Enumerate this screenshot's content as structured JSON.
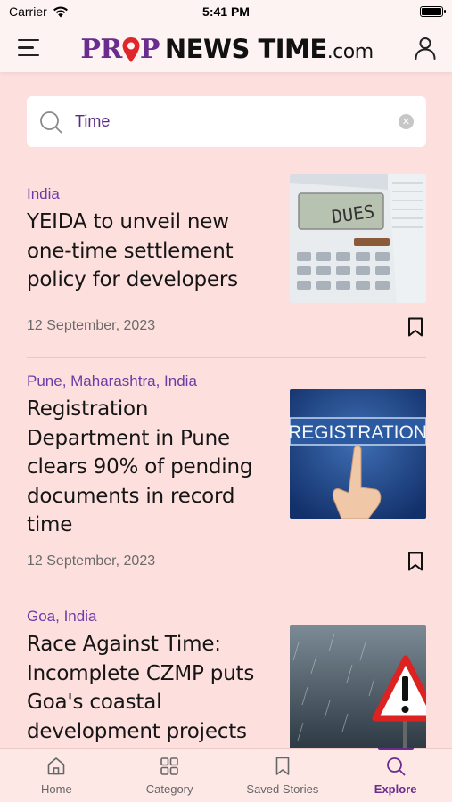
{
  "status_bar": {
    "carrier": "Carrier",
    "time": "5:41 PM"
  },
  "header": {
    "logo_prop_left": "PR",
    "logo_prop_right": "P",
    "logo_news": "NEWS TIME",
    "logo_com": ".com"
  },
  "search": {
    "value": "Time",
    "placeholder": "Search"
  },
  "articles": [
    {
      "category": "India",
      "title": "YEIDA to unveil new one-time settlement policy for developers",
      "date": "12 September, 2023",
      "image_text": "DUES"
    },
    {
      "category": "Pune, Maharashtra, India",
      "title": "Registration Department in Pune clears 90% of pending documents in record time",
      "date": "12 September, 2023",
      "image_text": "REGISTRATION"
    },
    {
      "category": "Goa, India",
      "title": "Race Against Time: Incomplete CZMP puts Goa's coastal development projects",
      "date": "",
      "image_text": ""
    }
  ],
  "bottom_nav": [
    {
      "label": "Home",
      "icon": "home-icon",
      "active": false
    },
    {
      "label": "Category",
      "icon": "grid-icon",
      "active": false
    },
    {
      "label": "Saved Stories",
      "icon": "bookmark-icon",
      "active": false
    },
    {
      "label": "Explore",
      "icon": "search-icon",
      "active": true
    }
  ],
  "colors": {
    "background": "#fde0de",
    "brand_purple": "#6a2c8e",
    "category_purple": "#6e3aa7",
    "logo_pin_red": "#e0262b"
  }
}
